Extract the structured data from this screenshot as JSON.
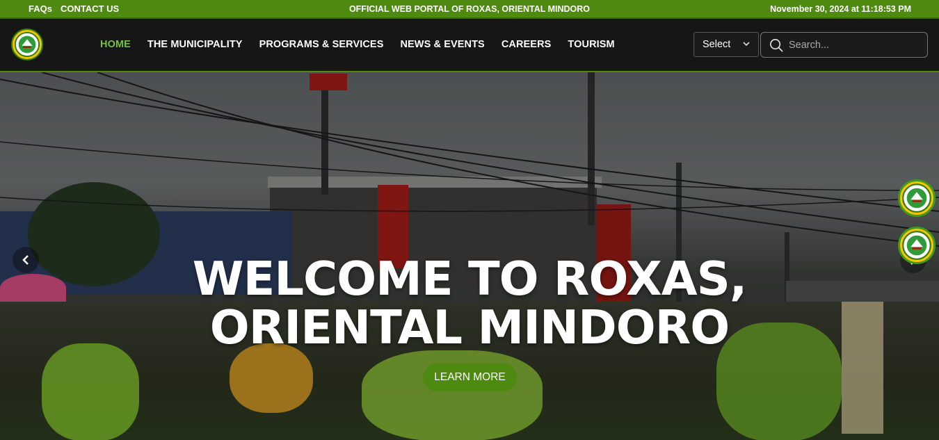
{
  "topbar": {
    "faqs": "FAQs",
    "contact": "CONTACT US",
    "portal_title": "OFFICIAL WEB PORTAL OF ROXAS, ORIENTAL MINDORO",
    "datetime": "November 30, 2024 at 11:18:53 PM"
  },
  "nav": {
    "logo_icon": "municipal-seal-icon",
    "items": [
      {
        "label": "HOME",
        "active": true
      },
      {
        "label": "THE MUNICIPALITY",
        "active": false
      },
      {
        "label": "PROGRAMS & SERVICES",
        "active": false
      },
      {
        "label": "NEWS & EVENTS",
        "active": false
      },
      {
        "label": "CAREERS",
        "active": false
      },
      {
        "label": "TOURISM",
        "active": false
      }
    ],
    "language_select": "Select",
    "search_placeholder": "Search..."
  },
  "hero": {
    "title_line1": "WELCOME TO ROXAS,",
    "title_line2": "ORIENTAL MINDORO",
    "button": "LEARN MORE",
    "prev_icon": "chevron-left-icon",
    "next_icon": "chevron-right-icon",
    "side_badges": [
      "municipal-seal-icon",
      "municipal-seal-icon"
    ]
  },
  "colors": {
    "brand_green": "#4f8a10",
    "active_green": "#76c043",
    "nav_bg": "#161616"
  }
}
